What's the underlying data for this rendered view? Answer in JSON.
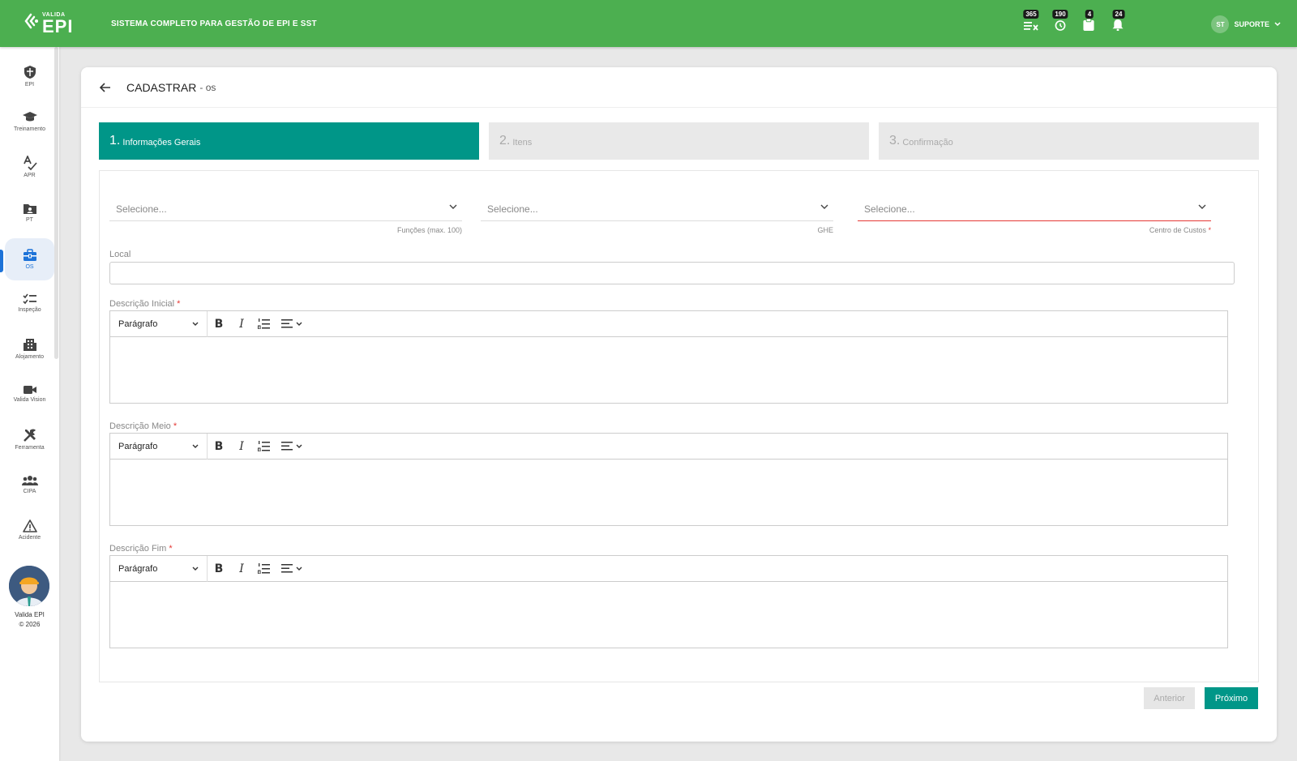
{
  "header": {
    "logo_small": "VALIDA",
    "logo_big": "EPI",
    "system_title": "SISTEMA COMPLETO PARA GESTÃO DE EPI E SST",
    "badges": [
      {
        "icon": "list-remove-icon",
        "count": "365"
      },
      {
        "icon": "clock-history-icon",
        "count": "190"
      },
      {
        "icon": "clipboard-icon",
        "count": "4"
      },
      {
        "icon": "bell-icon",
        "count": "24"
      }
    ],
    "user_initials": "ST",
    "user_name": "SUPORTE"
  },
  "sidebar": {
    "items": [
      {
        "label": "EPI",
        "icon": "shield-icon"
      },
      {
        "label": "Treinamento",
        "icon": "graduation-cap-icon"
      },
      {
        "label": "APR",
        "icon": "spellcheck-icon"
      },
      {
        "label": "PT",
        "icon": "folder-user-icon"
      },
      {
        "label": "OS",
        "icon": "toolbox-icon"
      },
      {
        "label": "Inspeção",
        "icon": "checklist-icon"
      },
      {
        "label": "Alojamento",
        "icon": "building-icon"
      },
      {
        "label": "Valida Vision",
        "icon": "video-camera-icon"
      },
      {
        "label": "Ferramenta",
        "icon": "tools-icon"
      },
      {
        "label": "CIPA",
        "icon": "group-icon"
      },
      {
        "label": "Acidente",
        "icon": "warning-icon"
      }
    ],
    "active": "OS",
    "footer_name": "Valida EPI",
    "footer_copy": "© 2026"
  },
  "page": {
    "title": "CADASTRAR",
    "subtitle": "- os"
  },
  "steps": [
    {
      "num": "1.",
      "label": "Informações Gerais"
    },
    {
      "num": "2.",
      "label": "Itens"
    },
    {
      "num": "3.",
      "label": "Confirmação"
    }
  ],
  "form": {
    "selects": [
      {
        "placeholder": "Selecione...",
        "label": "Funções (max. 100)"
      },
      {
        "placeholder": "Selecione...",
        "label": "GHE"
      },
      {
        "placeholder": "Selecione...",
        "label": "Centro de Custos",
        "required": "*"
      }
    ],
    "local_label": "Local",
    "editors": [
      {
        "label": "Descrição Inicial",
        "required": "*",
        "format": "Parágrafo"
      },
      {
        "label": "Descrição Meio",
        "required": "*",
        "format": "Parágrafo"
      },
      {
        "label": "Descrição Fim",
        "required": "*",
        "format": "Parágrafo"
      }
    ],
    "toolbar": {
      "bold": "B",
      "italic": "I"
    }
  },
  "buttons": {
    "prev": "Anterior",
    "next": "Próximo"
  },
  "colors": {
    "topbar": "#4caf50",
    "primary": "#009688",
    "accent": "#1e73d8",
    "error": "#e53935"
  }
}
